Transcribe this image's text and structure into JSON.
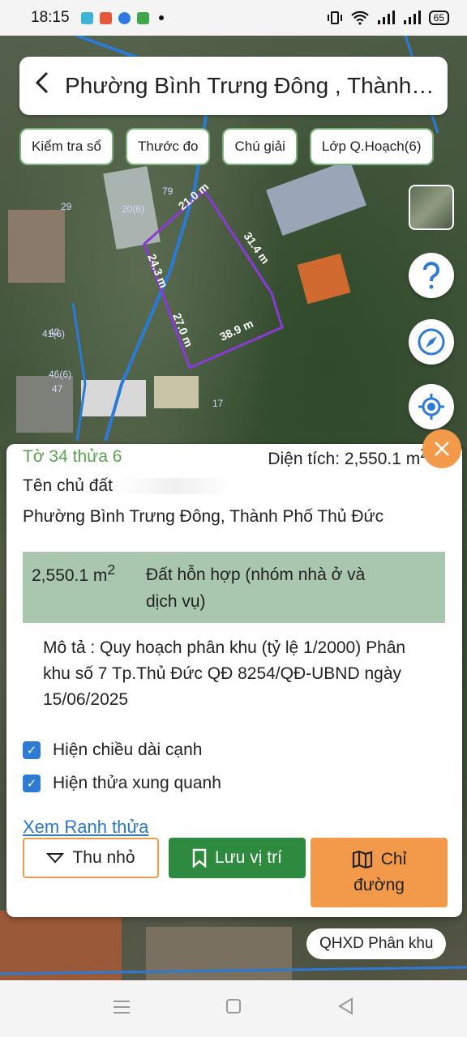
{
  "status": {
    "time": "18:15",
    "battery": "65"
  },
  "header": {
    "title": "Phường Bình Trưng Đông , Thành Phố Thủ Đức"
  },
  "chips": [
    "Kiểm tra sổ",
    "Thước đo",
    "Chú giải",
    "Lớp Q.Hoạch(6)"
  ],
  "map": {
    "labels": [
      "21.0 m",
      "24.3 m",
      "27.0 m",
      "31.4 m",
      "38.9 m"
    ],
    "parcel_numbers": [
      "20(6)",
      "79",
      "29",
      "42",
      "46(6)",
      "47",
      "41(6)",
      "17"
    ]
  },
  "panel": {
    "lot": "Tờ 34 thửa 6",
    "area_label": "Diện tích: 2,550.1 m",
    "area_sup": "2",
    "owner_label": "Tên chủ đất",
    "address": "Phường Bình Trưng Đông, Thành Phố Thủ Đức",
    "zone_area": "2,550.1 m",
    "zone_area_sup": "2",
    "zone_desc": "Đất hỗn hợp (nhóm nhà ở và dịch vụ)",
    "description": "Mô tả : Quy hoạch phân khu (tỷ lệ 1/2000) Phân khu số 7 Tp.Thủ Đức QĐ 8254/QĐ-UBND ngày 15/06/2025",
    "checkbox_edges": "Hiện chiều dài cạnh",
    "checkbox_neighbors": "Hiện thửa xung quanh",
    "link_boundary": "Xem Ranh thửa",
    "btn_collapse": "Thu nhỏ",
    "btn_save": "Lưu vị trí",
    "btn_directions_1": "Chỉ",
    "btn_directions_2": "đường"
  },
  "bottom_tag": "QHXD Phân khu",
  "colors": {
    "accent_green": "#2e8a3e",
    "accent_orange": "#f29a4a",
    "parcel_line": "#8a3ad6",
    "zone_bg": "#a9c6ae",
    "link": "#2a78c8"
  }
}
